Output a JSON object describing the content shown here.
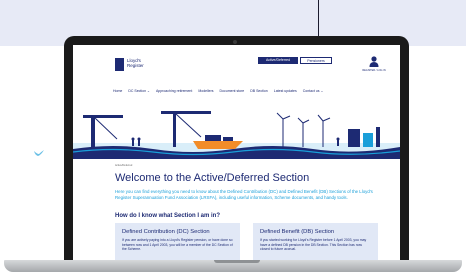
{
  "header": {
    "logo_line1": "Lloyd's",
    "logo_line2": "Register",
    "active_button": "Active/Deferred",
    "pensioner_button": "Pensioners",
    "account_label": "REGISTER / LOG IN"
  },
  "nav": {
    "items": [
      "Home",
      "DC Section ⌄",
      "Approaching retirement",
      "Modellers",
      "Document store",
      "DB Section",
      "Latest updates",
      "Contact us ⌄"
    ]
  },
  "breadcrumb": "Active/Deferred",
  "page": {
    "title": "Welcome to the Active/Deferred Section",
    "intro": "Here you can find everything you need to know about the Defined Contribution (DC) and Defined Benefit (DB) Sections of the Lloyd's Register Superannuation Fund Association (LRSFA), including useful information, Scheme documents, and handy tools.",
    "subheading": "How do I know what Section I am in?"
  },
  "cards": {
    "dc": {
      "title": "Defined Contribution (DC) Section",
      "body": "If you are actively paying into a Lloyd's Register pension, or have done so between now and 1 April 2003, you will be a member of the DC Section of the Scheme."
    },
    "db": {
      "title": "Defined Benefit (DB) Section",
      "body": "If you started working for Lloyd's Register before 1 April 2003, you may have a defined DB pension in the DB Section. This Section has now closed to future accrual."
    }
  },
  "icons": {
    "bird": "bird-icon",
    "account": "user-icon",
    "logo": "lloyds-register-logo"
  },
  "colors": {
    "navy": "#1d2a73",
    "accent_blue": "#1a9fd9",
    "card_bg": "#e1e8f6",
    "band": "#e7eaf6"
  }
}
